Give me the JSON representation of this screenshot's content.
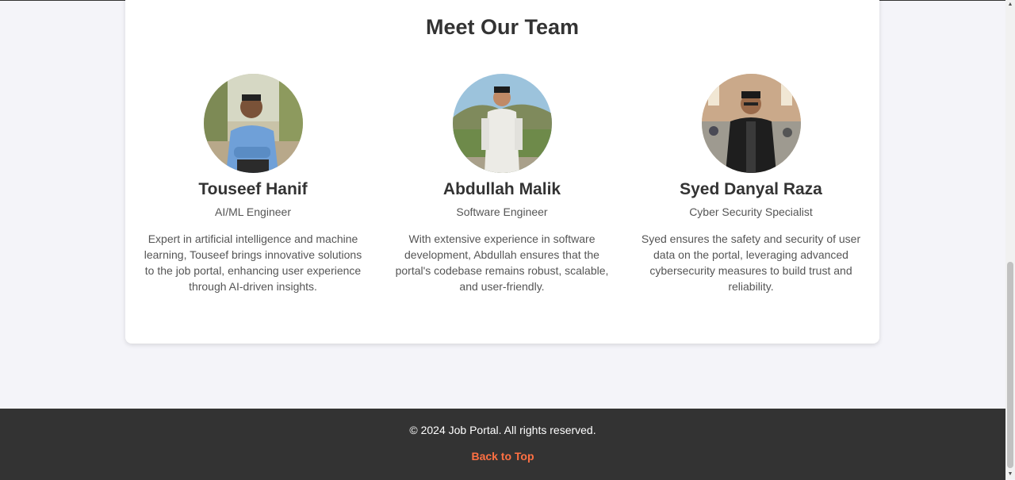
{
  "team": {
    "title": "Meet Our Team",
    "members": [
      {
        "name": "Touseef Hanif",
        "role": "AI/ML Engineer",
        "description": "Expert in artificial intelligence and machine learning, Touseef brings innovative solutions to the job portal, enhancing user experience through AI-driven insights."
      },
      {
        "name": "Abdullah Malik",
        "role": "Software Engineer",
        "description": "With extensive experience in software development, Abdullah ensures that the portal's codebase remains robust, scalable, and user-friendly."
      },
      {
        "name": "Syed Danyal Raza",
        "role": "Cyber Security Specialist",
        "description": "Syed ensures the safety and security of user data on the portal, leveraging advanced cybersecurity measures to build trust and reliability."
      }
    ]
  },
  "footer": {
    "copyright": "© 2024 Job Portal. All rights reserved.",
    "back_to_top": "Back to Top"
  },
  "colors": {
    "accent": "#ff7043",
    "footer_bg": "#333333",
    "page_bg": "#f4f4f9"
  },
  "icons": {
    "scroll_up": "scroll-up-arrow-icon",
    "scroll_down": "scroll-down-arrow-icon"
  }
}
